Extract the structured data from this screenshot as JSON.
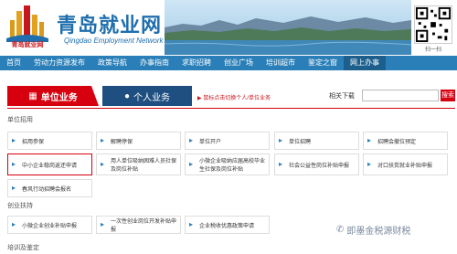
{
  "header": {
    "logo_text": "青岛就业网",
    "title": "青岛就业网",
    "subtitle": "Qingdao Employment Network",
    "qr_label": "扫一扫"
  },
  "nav": {
    "items": [
      "首页",
      "劳动力资源发布",
      "政策导航",
      "办事指南",
      "求职招聘",
      "创业广场",
      "培训超市",
      "鉴定之窗",
      "网上办事"
    ],
    "active_index": 8
  },
  "tabs": {
    "unit": "单位业务",
    "personal": "个人业务",
    "note": "鼠标点击切换个人/单位业务"
  },
  "search": {
    "label": "相关下载",
    "button": "搜索"
  },
  "sections": [
    {
      "title": "单位招用",
      "rows": [
        [
          "招用参保",
          "解聘停保",
          "单位开户",
          "单位招聘",
          "招聘会撤位预定"
        ],
        [
          "中小企业稳岗返还申请",
          "用人单位吸纳困难人员社保及岗位补贴",
          "小微企业吸纳应届高校毕业生社保及岗位补贴",
          "社会公益性岗位补贴申报",
          "对口扶贫就业补贴申报"
        ],
        [
          "春风行动招聘会报名"
        ]
      ],
      "highlighted": "中小企业稳岗返还申请"
    },
    {
      "title": "创业扶持",
      "rows": [
        [
          "小微企业创业补贴申报",
          "一次性创业岗位开发补贴申报",
          "企业税收优惠政策申请"
        ]
      ]
    },
    {
      "title": "培训及鉴定",
      "rows": []
    }
  ],
  "watermark": "即墨金税源财税",
  "colors": {
    "brand_blue": "#2a7fb8",
    "accent_red": "#d7000f",
    "dark_blue": "#1f4f80"
  }
}
